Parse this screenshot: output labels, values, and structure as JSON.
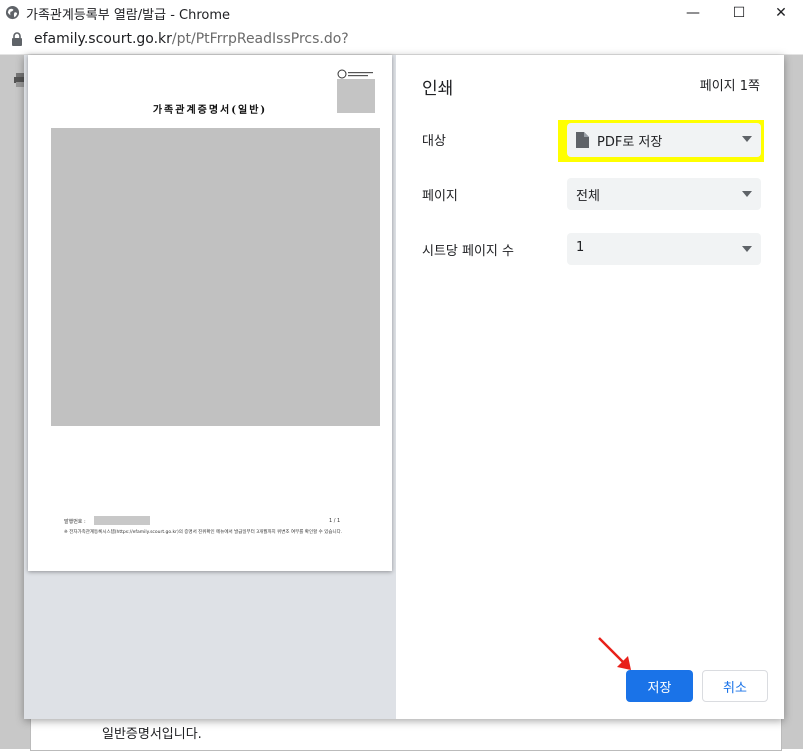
{
  "window": {
    "title": "가족관계등록부 열람/발급 - Chrome",
    "minimize_glyph": "—",
    "maximize_glyph": "☐",
    "close_glyph": "✕"
  },
  "address_bar": {
    "host": "efamily.scourt.go.kr",
    "path": "/pt/PtFrrpReadIssPrcs.do?"
  },
  "background_page": {
    "visible_text": "일반증명서입니다."
  },
  "preview": {
    "document_title": "가족관계증명서(일반)",
    "issue_number_label": "발행번호 :",
    "page_count": "1 / 1",
    "notice": "※ 전자가족관계등록시스템(https://efamily.scourt.go.kr)의 증명서 진위확인 메뉴에서 발급일부터 3개월까지 위변조 여부를 확인할 수 있습니다."
  },
  "print_settings": {
    "heading": "인쇄",
    "page_count": "페이지 1쪽",
    "rows": [
      {
        "label": "대상",
        "value": "PDF로 저장"
      },
      {
        "label": "페이지",
        "value": "전체"
      },
      {
        "label": "시트당 페이지 수",
        "value": "1"
      }
    ],
    "save_label": "저장",
    "cancel_label": "취소"
  },
  "colors": {
    "accent": "#1a73e8",
    "highlight": "#ffff00",
    "preview_background": "#dee1e6",
    "annotation_arrow": "#e8201a"
  }
}
